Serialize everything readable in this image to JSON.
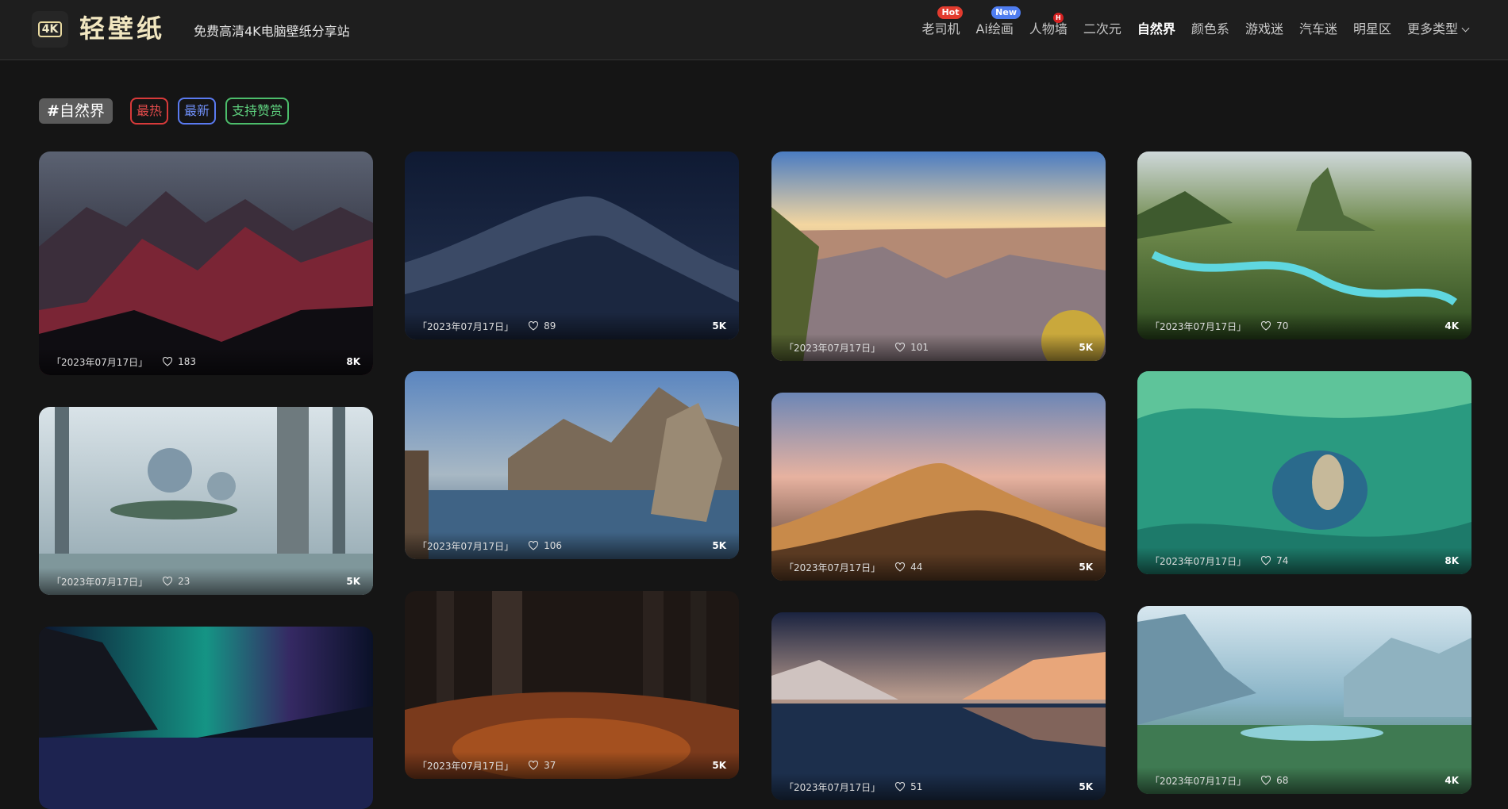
{
  "header": {
    "logo_badge": "4K",
    "logo_text": "轻壁纸",
    "tagline": "免费高清4K电脑壁纸分享站",
    "nav": [
      {
        "label": "老司机",
        "badge": "Hot"
      },
      {
        "label": "Ai绘画",
        "badge": "New"
      },
      {
        "label": "人物墙",
        "badge": "H"
      },
      {
        "label": "二次元"
      },
      {
        "label": "自然界",
        "active": true
      },
      {
        "label": "颜色系"
      },
      {
        "label": "游戏迷"
      },
      {
        "label": "汽车迷"
      },
      {
        "label": "明星区"
      },
      {
        "label": "更多类型",
        "dropdown": true
      }
    ]
  },
  "filters": {
    "category": "自然界",
    "hot": "最热",
    "new": "最新",
    "support": "支持赞赏"
  },
  "cards": [
    {
      "date": "「2023年07月17日」",
      "likes": "183",
      "res": "8K"
    },
    {
      "date": "「2023年07月17日」",
      "likes": "89",
      "res": "5K"
    },
    {
      "date": "「2023年07月17日」",
      "likes": "101",
      "res": "5K"
    },
    {
      "date": "「2023年07月17日」",
      "likes": "70",
      "res": "4K"
    },
    {
      "date": "「2023年07月17日」",
      "likes": "23",
      "res": "5K"
    },
    {
      "date": "「2023年07月17日」",
      "likes": "106",
      "res": "5K"
    },
    {
      "date": "「2023年07月17日」",
      "likes": "44",
      "res": "5K"
    },
    {
      "date": "「2023年07月17日」",
      "likes": "74",
      "res": "8K"
    },
    {
      "date": "",
      "likes": "",
      "res": ""
    },
    {
      "date": "「2023年07月17日」",
      "likes": "37",
      "res": "5K"
    },
    {
      "date": "「2023年07月17日」",
      "likes": "51",
      "res": "5K"
    },
    {
      "date": "「2023年07月17日」",
      "likes": "68",
      "res": "4K"
    }
  ]
}
